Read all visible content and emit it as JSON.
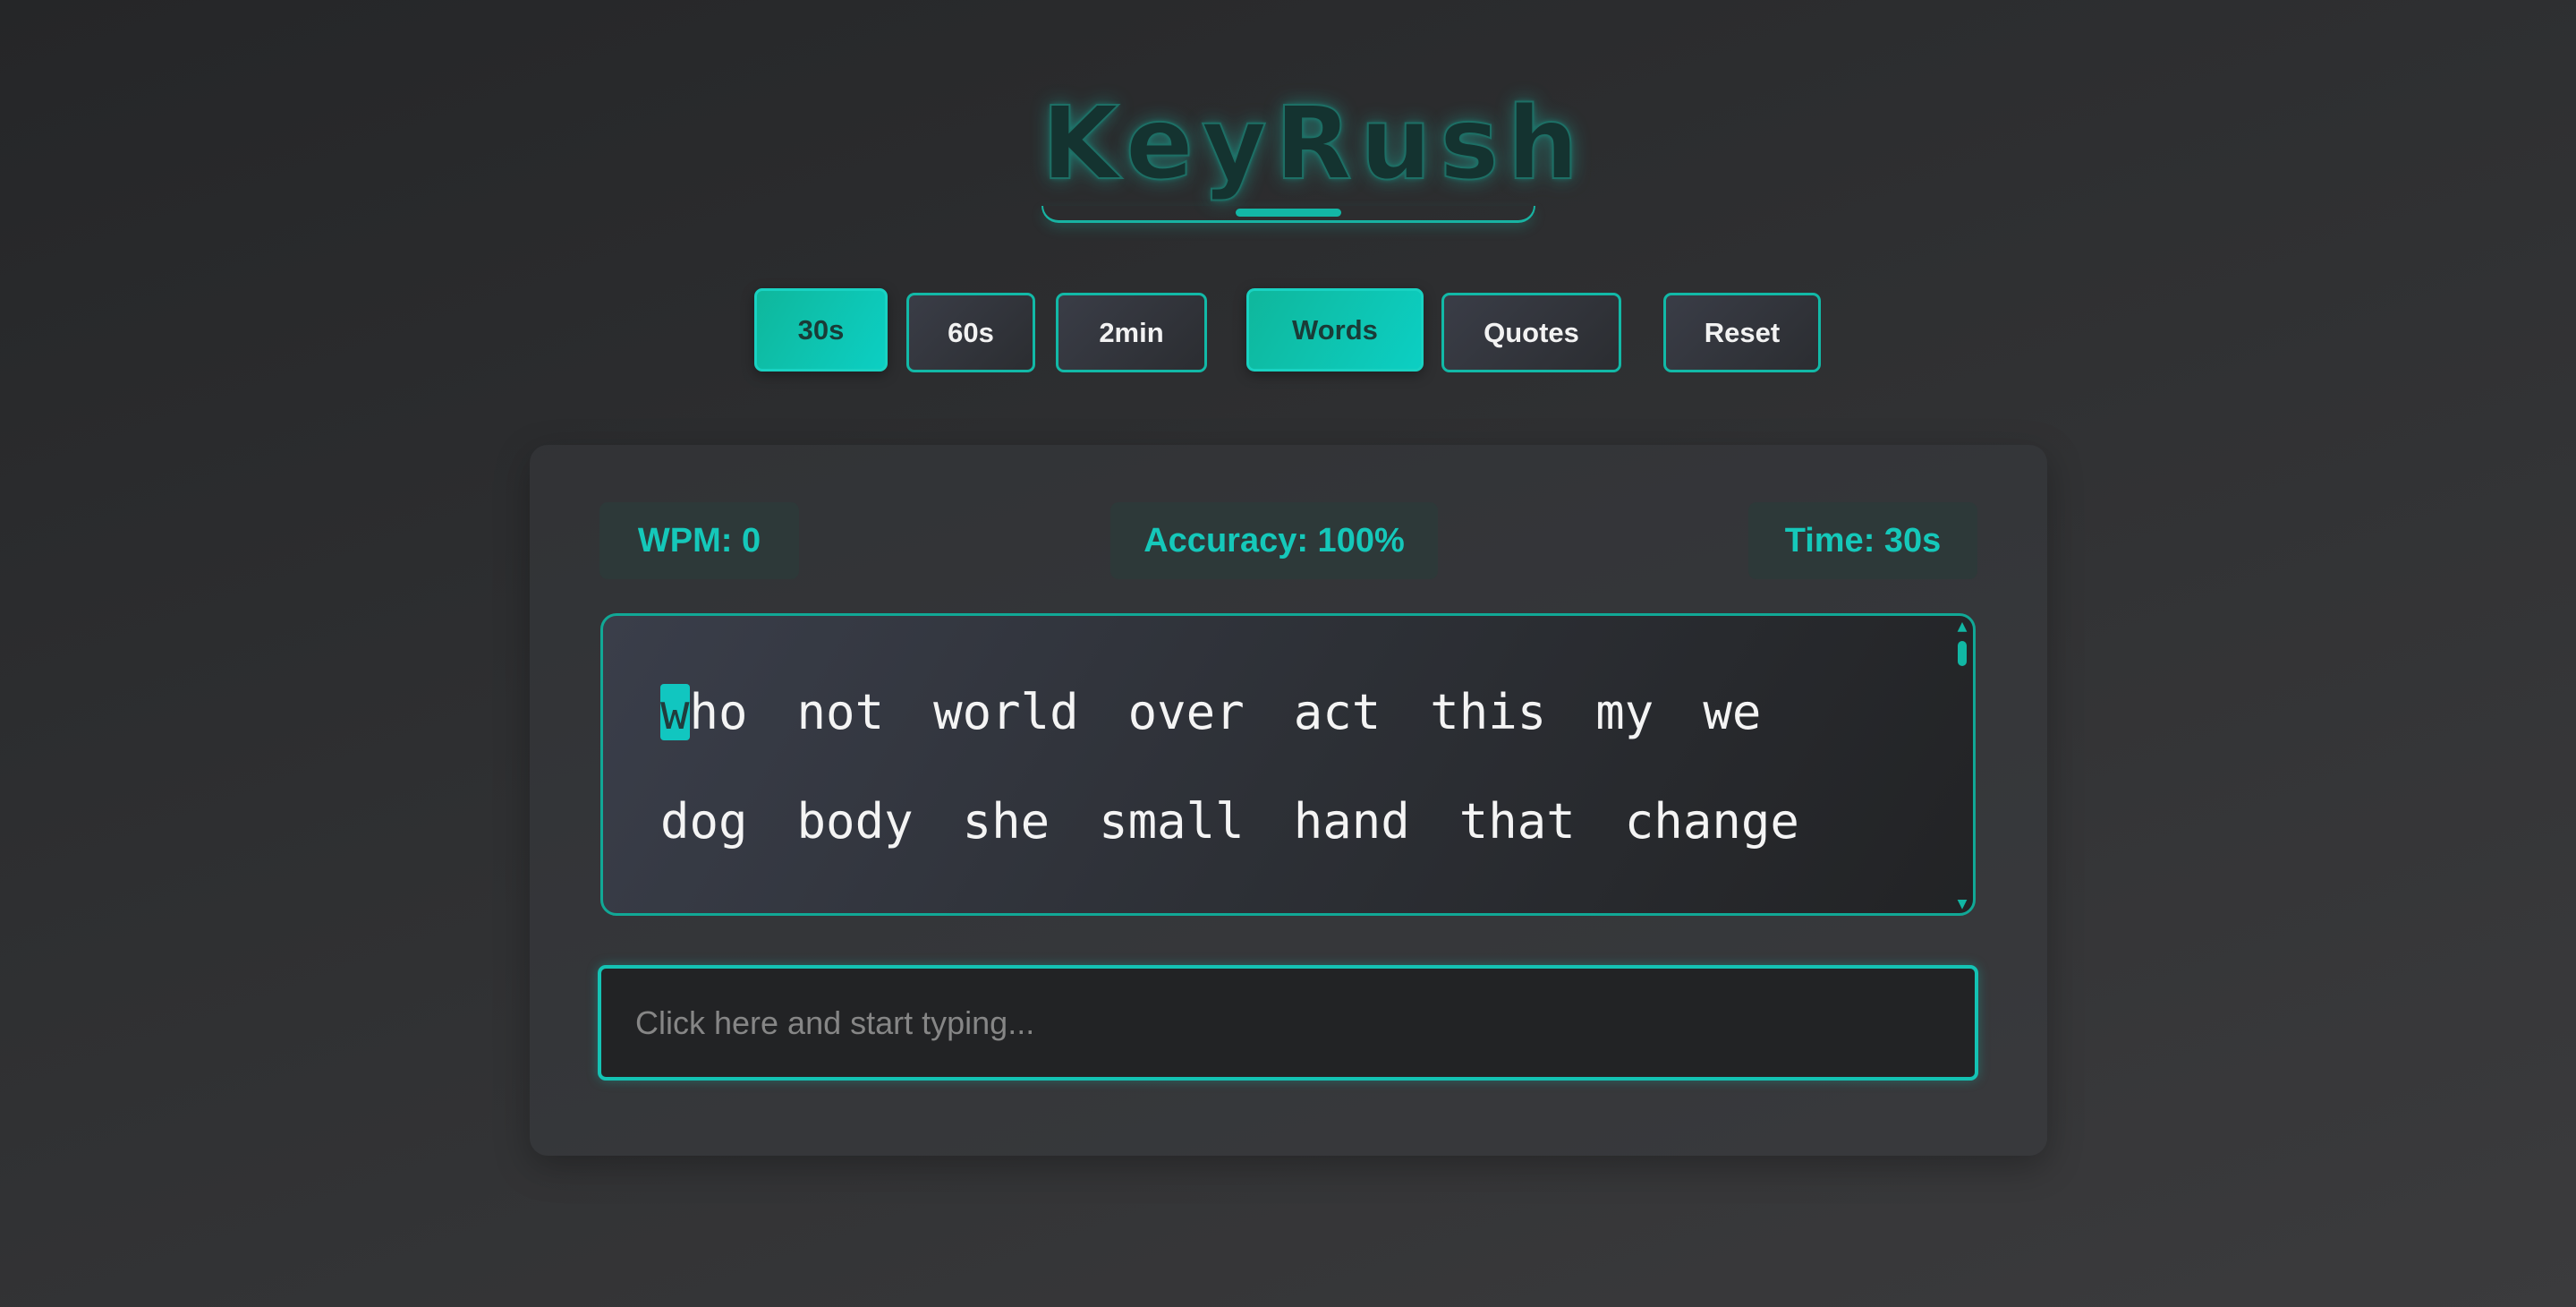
{
  "app": {
    "title": "KeyRush"
  },
  "modes": {
    "time_options": [
      {
        "label": "30s",
        "active": true
      },
      {
        "label": "60s",
        "active": false
      },
      {
        "label": "2min",
        "active": false
      }
    ],
    "content_options": [
      {
        "label": "Words",
        "active": true
      },
      {
        "label": "Quotes",
        "active": false
      }
    ],
    "reset_label": "Reset"
  },
  "stats": {
    "wpm": "WPM: 0",
    "accuracy": "Accuracy: 100%",
    "time": "Time: 30s"
  },
  "text": {
    "current_char": "w",
    "first_word_rest": "ho",
    "line1_rest": [
      "not",
      "world",
      "over",
      "act",
      "this",
      "my",
      "we"
    ],
    "line2": [
      "dog",
      "body",
      "she",
      "small",
      "hand",
      "that",
      "change"
    ]
  },
  "input": {
    "placeholder": "Click here and start typing...",
    "value": ""
  },
  "colors": {
    "accent": "#12b9a7",
    "accent_bright": "#0ccfc3",
    "stat_text": "#15c8ba",
    "background": "#2f3032"
  },
  "icons": {
    "scroll_up": "▲",
    "scroll_down": "▼"
  }
}
